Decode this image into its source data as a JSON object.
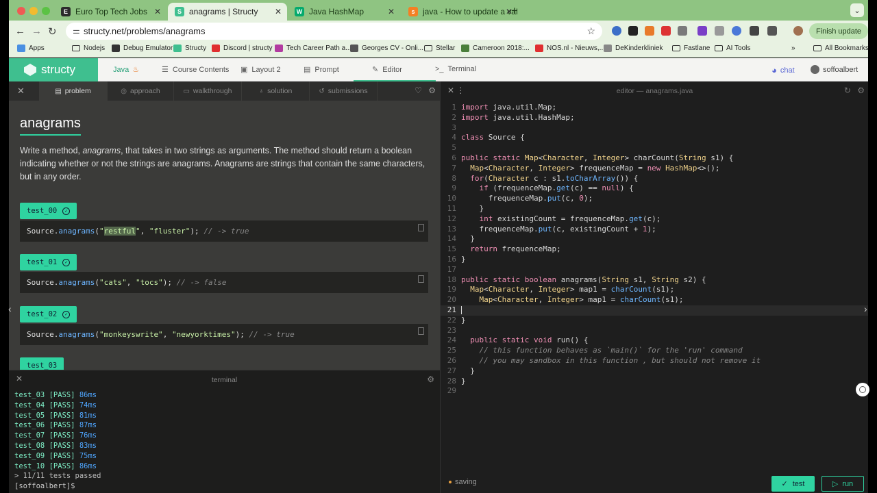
{
  "browser": {
    "tabs": [
      {
        "title": "Euro Top Tech Jobs",
        "fav_color": "#2b2b2b",
        "fav": "E"
      },
      {
        "title": "anagrams | Structy",
        "fav_color": "#3fbf8f",
        "fav": "S"
      },
      {
        "title": "Java HashMap",
        "fav_color": "#04aa6d",
        "fav": "W"
      },
      {
        "title": "java - How to update a value...",
        "fav_color": "#f48024",
        "fav": "s"
      }
    ],
    "url": "structy.net/problems/anagrams",
    "finish_update": "Finish update",
    "bookmarks": [
      {
        "label": "Apps",
        "color": "#4a90e2"
      },
      {
        "label": "Nodejs",
        "color": "folder"
      },
      {
        "label": "Debug Emulator",
        "color": "#333333"
      },
      {
        "label": "Structy",
        "color": "#3fbf8f"
      },
      {
        "label": "Discord | structy",
        "color": "#e03030"
      },
      {
        "label": "Tech Career Path a...",
        "color": "#b23ca0"
      },
      {
        "label": "Georges CV - Onli...",
        "color": "#555555"
      },
      {
        "label": "Stellar",
        "color": "folder"
      },
      {
        "label": "Cameroon 2018:...",
        "color": "#4a7f3a"
      },
      {
        "label": "NOS.nl - Nieuws,...",
        "color": "#e03030"
      },
      {
        "label": "DeKinderkliniek",
        "color": "#888888"
      },
      {
        "label": "Fastlane",
        "color": "folder"
      },
      {
        "label": "AI Tools",
        "color": "folder"
      }
    ],
    "all_bookmarks": "All Bookmarks"
  },
  "app": {
    "logo": "structy",
    "language": "Java",
    "nav": [
      "Course Contents",
      "Layout 2",
      "Prompt",
      "Editor",
      "Terminal"
    ],
    "chat": "chat",
    "user": "soffoalbert"
  },
  "problem": {
    "tabs": [
      "problem",
      "approach",
      "walkthrough",
      "solution",
      "submissions"
    ],
    "title": "anagrams",
    "desc_pre": "Write a method, ",
    "desc_em": "anagrams",
    "desc_post": ", that takes in two strings as arguments. The method should return a boolean indicating whether or not the strings are anagrams. Anagrams are strings that contain the same characters, but in any order.",
    "tests": [
      {
        "label": "test_00",
        "obj": "Source.",
        "fn": "anagrams",
        "a": "\"restful\"",
        "b": "\"fluster\"",
        "comment": "// -> true"
      },
      {
        "label": "test_01",
        "obj": "Source.",
        "fn": "anagrams",
        "a": "\"cats\"",
        "b": "\"tocs\"",
        "comment": "// -> false"
      },
      {
        "label": "test_02",
        "obj": "Source.",
        "fn": "anagrams",
        "a": "\"monkeyswrite\"",
        "b": "\"newyorktimes\"",
        "comment": "// -> true"
      },
      {
        "label": "test_03"
      }
    ]
  },
  "terminal": {
    "title": "terminal",
    "lines": [
      {
        "name": "test_03 [PASS]",
        "ms": "86ms"
      },
      {
        "name": "test_04 [PASS]",
        "ms": "74ms"
      },
      {
        "name": "test_05 [PASS]",
        "ms": "81ms"
      },
      {
        "name": "test_06 [PASS]",
        "ms": "87ms"
      },
      {
        "name": "test_07 [PASS]",
        "ms": "76ms"
      },
      {
        "name": "test_08 [PASS]",
        "ms": "83ms"
      },
      {
        "name": "test_09 [PASS]",
        "ms": "75ms"
      },
      {
        "name": "test_10 [PASS]",
        "ms": "86ms"
      }
    ],
    "summary": "> 11/11 tests passed",
    "prompt": "[soffoalbert]$"
  },
  "editor": {
    "title": "editor — anagrams.java",
    "current_line": 21,
    "lines": [
      "<span class='k'>import</span> java.util.Map;",
      "<span class='k'>import</span> java.util.HashMap;",
      "",
      "<span class='k'>class</span> Source {",
      "",
      "<span class='k'>public static</span> <span class='t'>Map</span>&lt;<span class='t'>Character</span>, <span class='t'>Integer</span>&gt; charCount(<span class='t'>String</span> s1) {",
      "  <span class='t'>Map</span>&lt;<span class='t'>Character</span>, <span class='t'>Integer</span>&gt; frequenceMap = <span class='k'>new</span> <span class='t'>HashMap</span>&lt;&gt;();",
      "  <span class='k'>for</span>(<span class='t'>Character</span> c : s1.<span class='m'>toCharArray</span>()) {",
      "    <span class='k'>if</span> (frequenceMap.<span class='m'>get</span>(c) == <span class='k'>null</span>) {",
      "      frequenceMap.<span class='m'>put</span>(c, <span class='n'>0</span>);",
      "    }",
      "    <span class='k'>int</span> existingCount = frequenceMap.<span class='m'>get</span>(c);",
      "    frequenceMap.<span class='m'>put</span>(c, existingCount + <span class='n'>1</span>);",
      "  }",
      "  <span class='k'>return</span> frequenceMap;",
      "}",
      "",
      "<span class='k'>public static</span> <span class='k'>boolean</span> anagrams(<span class='t'>String</span> s1, <span class='t'>String</span> s2) {",
      "  <span class='t'>Map</span>&lt;<span class='t'>Character</span>, <span class='t'>Integer</span>&gt; map1 = <span class='m'>charCount</span>(s1);",
      "    <span class='t'>Map</span>&lt;<span class='t'>Character</span>, <span class='t'>Integer</span>&gt; map1 = <span class='m'>charCount</span>(s1);",
      "",
      "}",
      "",
      "  <span class='k'>public static</span> <span class='k'>void</span> run() {",
      "    <span class='c'>// this function behaves as `main()` for the 'run' command</span>",
      "    <span class='c'>// you may sandbox in this function , but should not remove it</span>",
      "  }",
      "}",
      ""
    ],
    "status": "saving",
    "test_btn": "test",
    "run_btn": "run"
  },
  "icons": {
    "close": "✕",
    "gear": "⚙",
    "heart": "♡",
    "check": "✓",
    "play": "▷"
  }
}
